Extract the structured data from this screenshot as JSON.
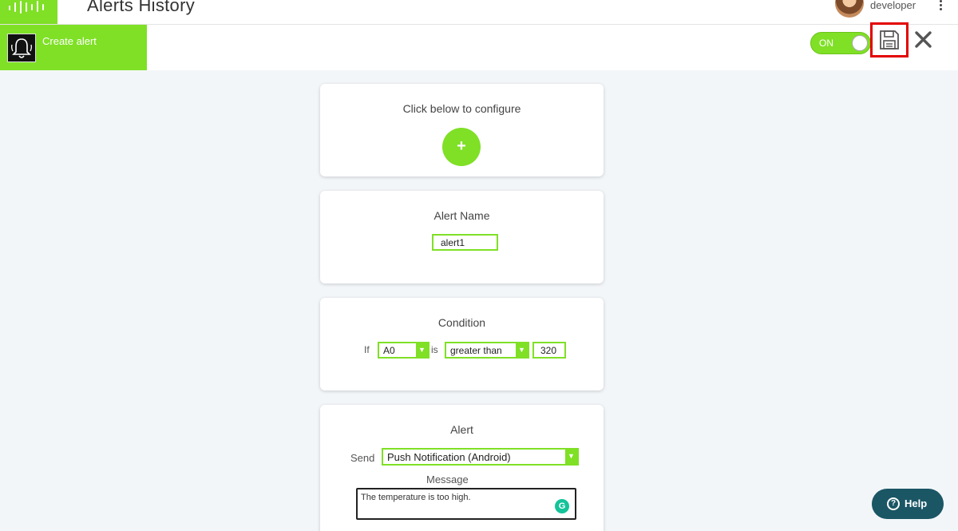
{
  "header": {
    "title": "Alerts History",
    "user_name": "developer"
  },
  "actionbar": {
    "create_alert_label": "Create alert",
    "toggle_label": "ON"
  },
  "configure": {
    "title": "Click below to configure",
    "plus_label": "+"
  },
  "alert_name": {
    "title": "Alert Name",
    "value": "alert1"
  },
  "condition": {
    "title": "Condition",
    "if_label": "If",
    "pin_value": "A0",
    "is_label": "is",
    "operator_value": "greater than",
    "threshold_value": "320"
  },
  "alert": {
    "title": "Alert",
    "send_label": "Send",
    "send_value": "Push Notification (Android)",
    "message_label": "Message",
    "message_value": "The temperature is too high."
  },
  "help": {
    "label": "Help",
    "icon_char": "?"
  },
  "colors": {
    "accent": "#7fe026",
    "highlight": "#e30000",
    "help_bg": "#1b5665",
    "background": "#f3f6f9"
  }
}
